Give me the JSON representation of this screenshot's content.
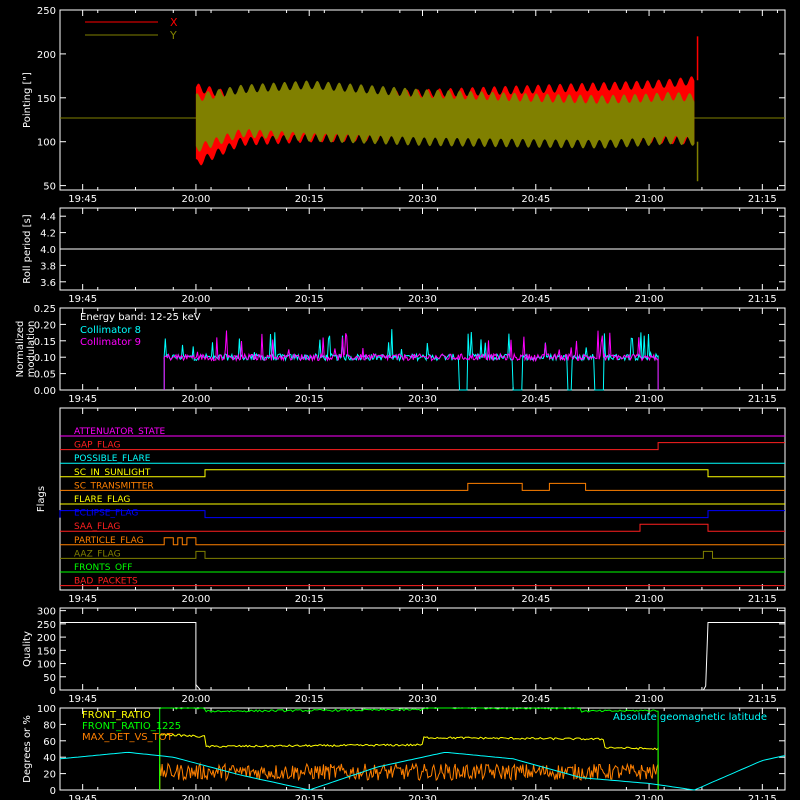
{
  "time_ticks": [
    "19:45",
    "20:00",
    "20:15",
    "20:30",
    "20:45",
    "21:00",
    "21:15"
  ],
  "chart_data": [
    {
      "id": "pointing",
      "type": "area",
      "ylabel": "Pointing [\"]",
      "xlim": [
        19.7,
        21.3
      ],
      "ylim": [
        45,
        250
      ],
      "yticks": [
        50,
        100,
        150,
        200,
        250
      ],
      "legend": [
        {
          "name": "X",
          "color": "#ff0000"
        },
        {
          "name": "Y",
          "color": "#808000"
        }
      ],
      "legend_position": "top-left",
      "baseline": 127,
      "series": [
        {
          "name": "X",
          "color": "#ff0000",
          "x": [
            20.0,
            20.1,
            20.25,
            20.5,
            20.75,
            20.9,
            21.0,
            21.05,
            21.1
          ],
          "upper": [
            162,
            150,
            150,
            155,
            160,
            163,
            165,
            167,
            170
          ],
          "lower": [
            75,
            100,
            104,
            106,
            105,
            104,
            103,
            102,
            102
          ]
        },
        {
          "name": "Y",
          "color": "#808000",
          "x": [
            20.0,
            20.1,
            20.25,
            20.5,
            20.75,
            20.9,
            21.0,
            21.05,
            21.1
          ],
          "upper": [
            150,
            160,
            165,
            155,
            150,
            148,
            150,
            152,
            150
          ],
          "lower": [
            92,
            110,
            105,
            100,
            98,
            97,
            100,
            102,
            100
          ]
        }
      ]
    },
    {
      "id": "roll",
      "type": "line",
      "ylabel": "Roll period [s]",
      "xlim": [
        19.7,
        21.3
      ],
      "ylim": [
        3.5,
        4.5
      ],
      "yticks": [
        3.6,
        3.8,
        4.0,
        4.2,
        4.4
      ],
      "series": [
        {
          "name": "",
          "color": "#ffffff",
          "x": [
            19.7,
            21.3
          ],
          "y": [
            4.0,
            4.0
          ]
        }
      ]
    },
    {
      "id": "modulation",
      "type": "line",
      "ylabel": "Normalized\nmodulation",
      "xlim": [
        19.7,
        21.3
      ],
      "ylim": [
        0.0,
        0.25
      ],
      "yticks": [
        0.0,
        0.05,
        0.1,
        0.15,
        0.2,
        0.25
      ],
      "annotation": "Energy band: 12-25 keV",
      "legend": [
        {
          "name": "Collimator 8",
          "color": "#00ffff"
        },
        {
          "name": "Collimator 9",
          "color": "#ff00ff"
        }
      ],
      "legend_position": "top-left",
      "series": [
        {
          "name": "Collimator 8",
          "color": "#00ffff",
          "x_start": 19.93,
          "x_end": 21.02,
          "level": 0.1,
          "dropouts": [
            [
              20.58,
              20.6
            ],
            [
              20.7,
              20.72
            ],
            [
              20.82,
              20.83
            ],
            [
              20.88,
              20.9
            ]
          ]
        },
        {
          "name": "Collimator 9",
          "color": "#ff00ff",
          "x_start": 19.93,
          "x_end": 21.02,
          "level": 0.1,
          "dropouts": []
        }
      ]
    },
    {
      "id": "flags",
      "type": "line",
      "ylabel": "Flags",
      "xlim": [
        19.7,
        21.3
      ],
      "flags": [
        {
          "name": "ATTENUATOR_STATE",
          "color": "#ff00ff",
          "highs": []
        },
        {
          "name": "GAP_FLAG",
          "color": "#ff2020",
          "highs": [
            [
              21.02,
              21.3
            ]
          ]
        },
        {
          "name": "POSSIBLE_FLARE",
          "color": "#00ffff",
          "highs": []
        },
        {
          "name": "SC_IN_SUNLIGHT",
          "color": "#ffff00",
          "highs": [
            [
              20.02,
              21.13
            ]
          ]
        },
        {
          "name": "SC_TRANSMITTER",
          "color": "#ff8000",
          "highs": [
            [
              20.6,
              20.72
            ],
            [
              20.78,
              20.86
            ]
          ]
        },
        {
          "name": "FLARE_FLAG",
          "color": "#ffff00",
          "highs": []
        },
        {
          "name": "ECLIPSE_FLAG",
          "color": "#0000ff",
          "highs": [
            [
              19.7,
              20.02
            ],
            [
              21.13,
              21.3
            ]
          ]
        },
        {
          "name": "SAA_FLAG",
          "color": "#ff2020",
          "highs": [
            [
              20.98,
              21.13
            ]
          ]
        },
        {
          "name": "PARTICLE_FLAG",
          "color": "#ff8000",
          "highs": [
            [
              19.93,
              19.95
            ],
            [
              19.96,
              19.97
            ],
            [
              19.98,
              20.0
            ]
          ]
        },
        {
          "name": "AAZ_FLAG",
          "color": "#808000",
          "highs": [
            [
              20.0,
              20.02
            ],
            [
              21.12,
              21.14
            ]
          ]
        },
        {
          "name": "FRONTS_OFF",
          "color": "#00ff00",
          "highs": []
        },
        {
          "name": "BAD_PACKETS",
          "color": "#ff2020",
          "highs": []
        }
      ]
    },
    {
      "id": "quality",
      "type": "line",
      "ylabel": "Quality",
      "xlim": [
        19.7,
        21.3
      ],
      "ylim": [
        0,
        310
      ],
      "yticks": [
        0,
        50,
        100,
        150,
        200,
        250,
        300
      ],
      "series": [
        {
          "name": "",
          "color": "#ffffff",
          "x": [
            19.7,
            20.0,
            20.0,
            20.01,
            20.02,
            21.12,
            21.125,
            21.13,
            21.3
          ],
          "y": [
            255,
            255,
            20,
            0,
            0,
            0,
            15,
            255,
            255
          ]
        }
      ]
    },
    {
      "id": "geomag",
      "type": "line",
      "ylabel": "Degrees or %",
      "xlim": [
        19.7,
        21.3
      ],
      "ylim": [
        0,
        100
      ],
      "yticks": [
        0,
        20,
        40,
        60,
        80,
        100
      ],
      "legend": [
        {
          "name": "FRONT_RATIO",
          "color": "#ffff00"
        },
        {
          "name": "FRONT_RATIO_1225",
          "color": "#00ff00"
        },
        {
          "name": "MAX_DET_VS_TOT",
          "color": "#ff8000"
        }
      ],
      "legend_position": "top-left",
      "annotation": "Absolute geomagnetic latitude",
      "series": [
        {
          "name": "FRONT_RATIO",
          "color": "#ffff00",
          "x": [
            19.92,
            20.02,
            20.02,
            20.5,
            20.5,
            20.9,
            20.9,
            21.02
          ],
          "y": [
            68,
            65,
            53,
            55,
            64,
            62,
            52,
            50
          ]
        },
        {
          "name": "FRONT_RATIO_1225",
          "color": "#00ff00",
          "x": [
            19.92,
            20.02,
            20.02,
            20.5,
            20.5,
            20.85,
            20.85,
            21.02
          ],
          "y": [
            100,
            100,
            96,
            98,
            100,
            100,
            96,
            97
          ]
        },
        {
          "name": "MAX_DET_VS_TOT",
          "color": "#ff8000",
          "x_start": 19.92,
          "x_end": 21.02,
          "mean": 22,
          "spread": 10
        },
        {
          "name": "Absolute geomagnetic latitude",
          "color": "#00ffff",
          "x": [
            19.7,
            19.85,
            19.95,
            20.1,
            20.25,
            20.4,
            20.55,
            20.7,
            20.85,
            21.0,
            21.1,
            21.25,
            21.3
          ],
          "y": [
            38,
            46,
            40,
            18,
            0,
            28,
            46,
            38,
            15,
            8,
            0,
            36,
            42
          ]
        }
      ]
    }
  ]
}
